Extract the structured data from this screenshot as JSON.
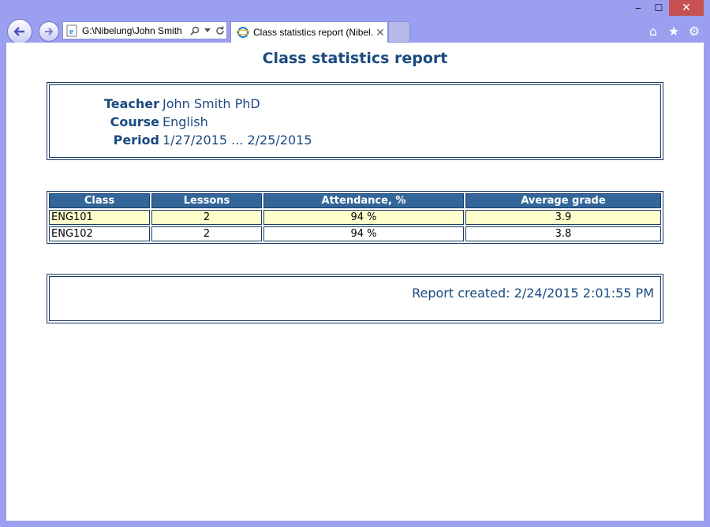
{
  "browser": {
    "address": "G:\\Nibelung\\John Smith",
    "tab_title": "Class statistics report (Nibel...",
    "tab_close": "✕",
    "window_controls": {
      "minimize": "‒",
      "maximize": "☐",
      "close": "✕"
    },
    "tools": {
      "home": "⌂",
      "favorites": "★",
      "settings": "⚙"
    },
    "icons": [
      "back-arrow-icon",
      "forward-arrow-icon",
      "ie-icon",
      "search-icon",
      "dropdown-icon",
      "refresh-icon",
      "home-icon",
      "star-icon",
      "gear-icon"
    ]
  },
  "report": {
    "title": "Class statistics report",
    "info": [
      {
        "label": "Teacher",
        "value": "John Smith PhD"
      },
      {
        "label": "Course",
        "value": "English"
      },
      {
        "label": "Period",
        "value": "1/27/2015 ... 2/25/2015"
      }
    ],
    "table": {
      "headers": [
        "Class",
        "Lessons",
        "Attendance, %",
        "Average grade"
      ],
      "rows": [
        [
          "ENG101",
          "2",
          "94 %",
          "3.9"
        ],
        [
          "ENG102",
          "2",
          "94 %",
          "3.8"
        ]
      ]
    },
    "created": "Report created: 2/24/2015 2:01:55 PM"
  },
  "colors": {
    "frame": "#9b9ff0",
    "header_bg": "#336699",
    "accent_text": "#1a4a80",
    "odd_row": "#ffffcc",
    "close_button": "#c75050"
  }
}
